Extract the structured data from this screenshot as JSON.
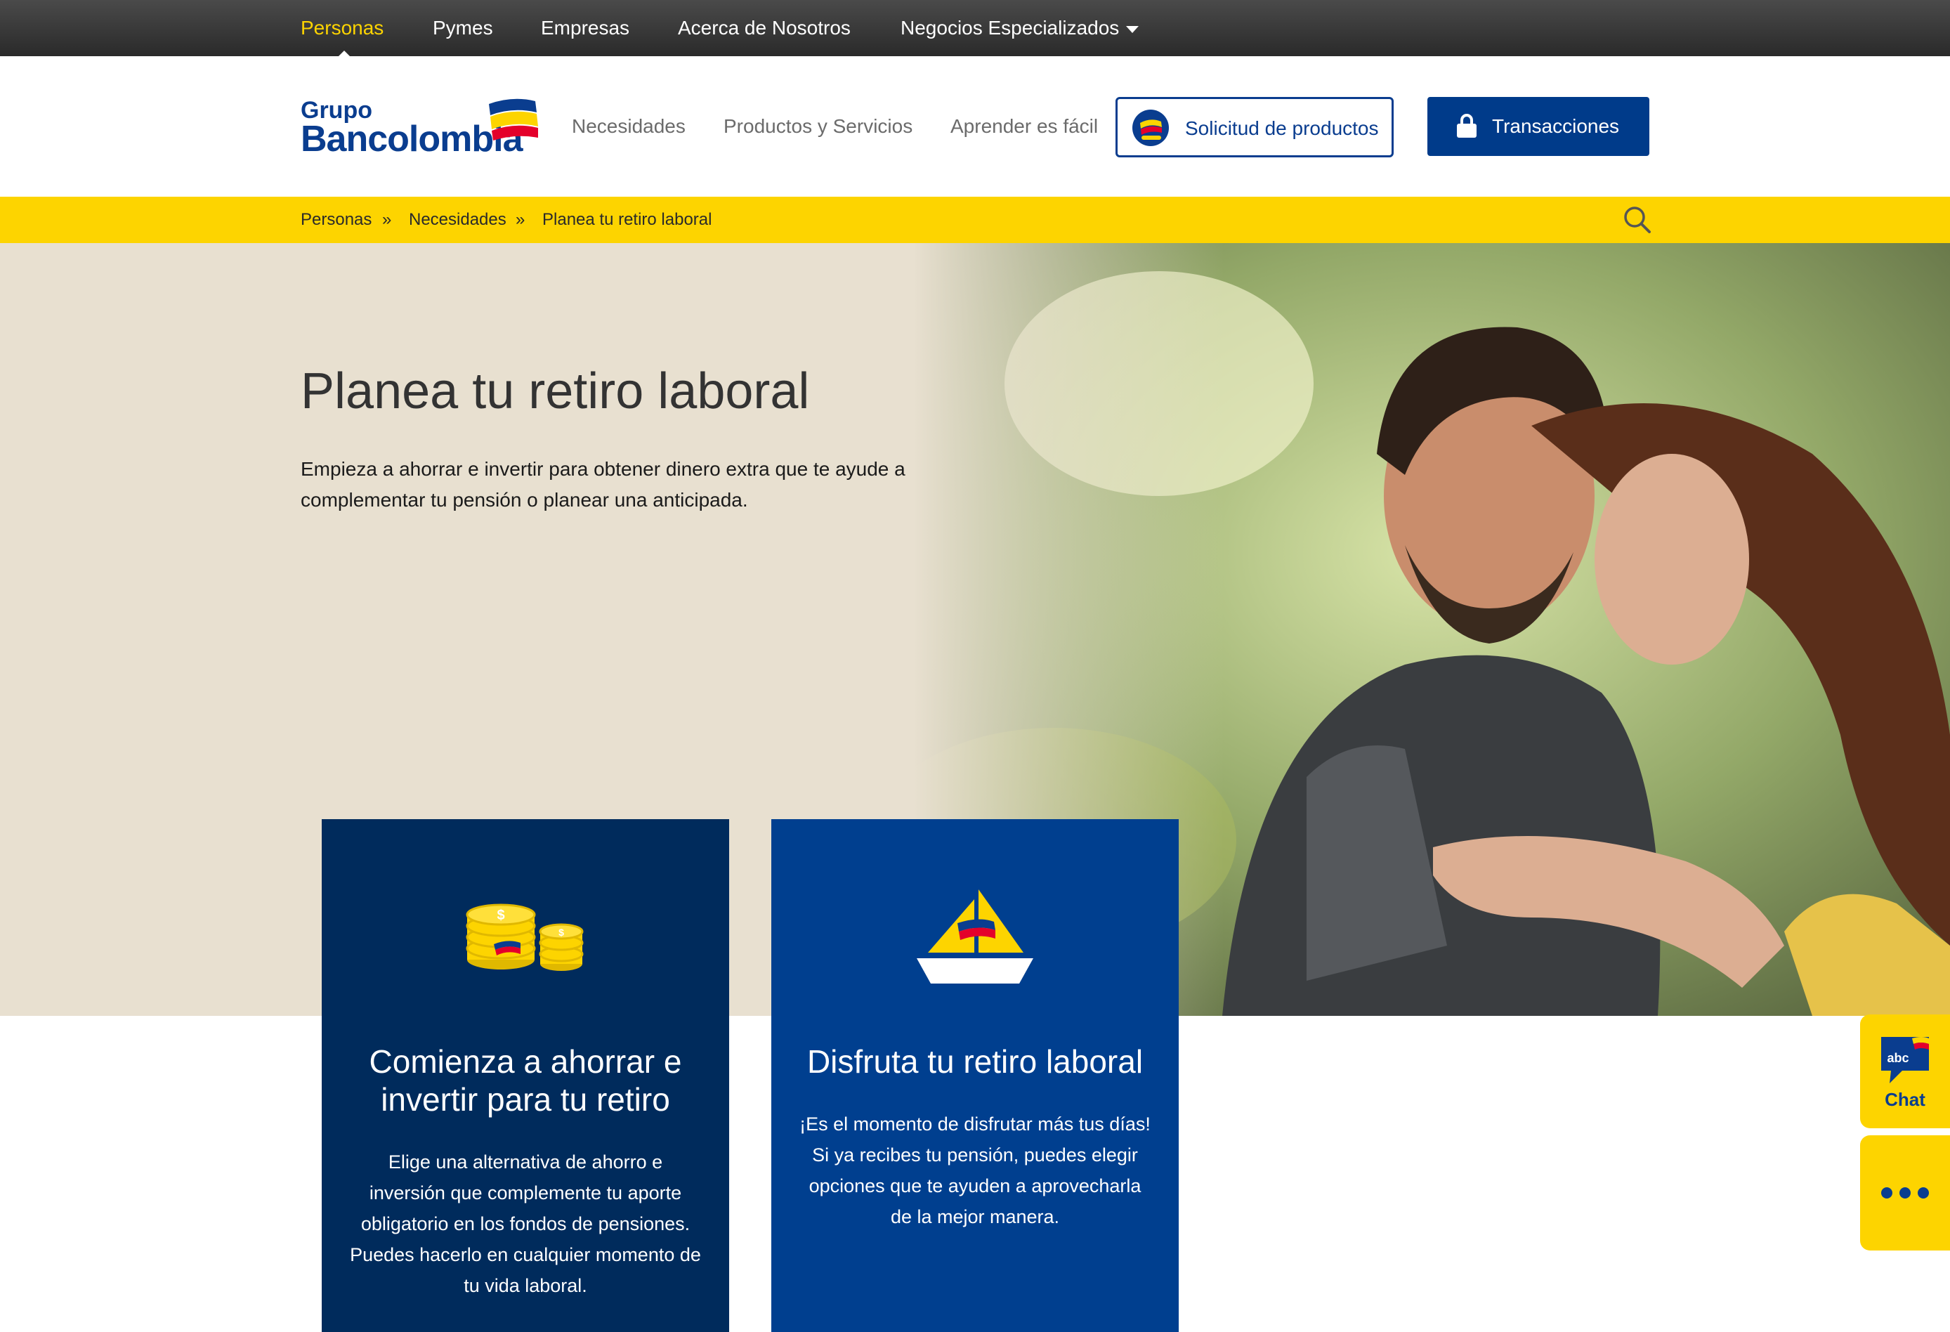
{
  "topbar": {
    "items": [
      "Personas",
      "Pymes",
      "Empresas",
      "Acerca de Nosotros",
      "Negocios Especializados"
    ],
    "active_color": "#fdd400"
  },
  "header": {
    "logo": {
      "line1": "Grupo",
      "line2": "Bancolombia"
    },
    "nav": [
      "Necesidades",
      "Productos y Servicios",
      "Aprender es fácil"
    ],
    "solicitud_label": "Solicitud de productos",
    "transacciones_label": "Transacciones"
  },
  "breadcrumb": {
    "items": [
      "Personas",
      "Necesidades",
      "Planea tu retiro laboral"
    ],
    "separator": "»"
  },
  "hero": {
    "title": "Planea tu retiro laboral",
    "text": "Empieza a ahorrar e invertir para obtener dinero extra que te ayude a complementar tu pensión o planear una anticipada."
  },
  "cards": [
    {
      "icon": "coins-icon",
      "title": "Comienza a ahorrar e invertir para tu retiro",
      "text": "Elige una alternativa de ahorro e inversión que complemente  tu aporte obligatorio en los fondos de pensiones. Puedes hacerlo en cualquier momento de tu vida laboral."
    },
    {
      "icon": "sailboat-icon",
      "title": "Disfruta tu retiro laboral",
      "text": "¡Es el momento de disfrutar más tus días! Si ya recibes tu pensión, puedes elegir opciones que te ayuden a aprovecharla de la mejor manera."
    }
  ],
  "chat": {
    "badge": "abc",
    "label": "Chat"
  },
  "colors": {
    "brand_blue": "#0a3d8f",
    "brand_yellow": "#fdd400",
    "card_dark": "#002b5c",
    "card_blue": "#003f8f"
  }
}
